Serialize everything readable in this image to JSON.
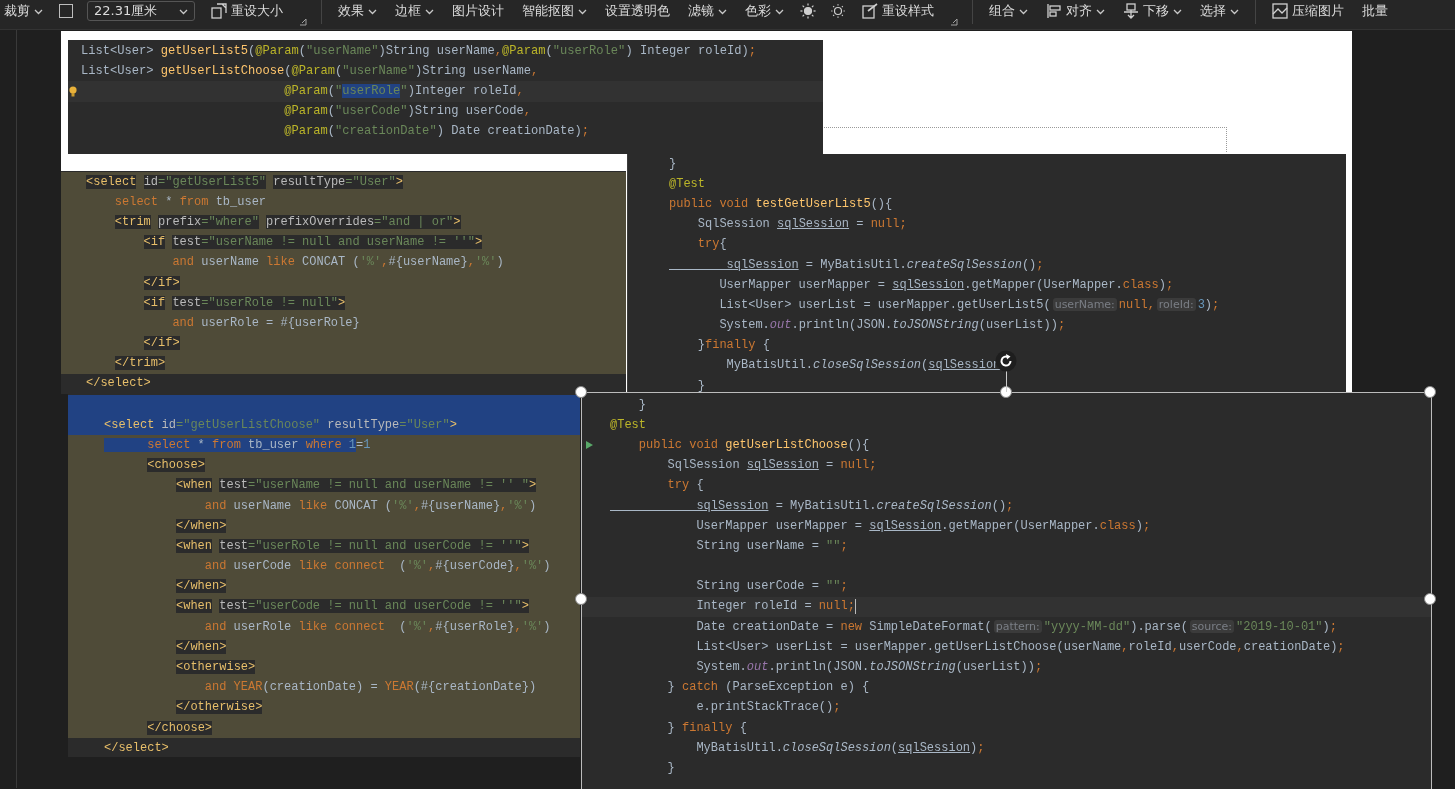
{
  "toolbar": {
    "groups": [
      [
        {
          "kind": "dropdown",
          "label": "裁剪"
        },
        {
          "kind": "checkbox",
          "checked": false
        },
        {
          "kind": "field",
          "value": "22.31厘米"
        },
        {
          "kind": "resize",
          "label": "重设大小"
        },
        {
          "kind": "launcher"
        }
      ],
      [
        {
          "kind": "dropdown",
          "label": "效果"
        },
        {
          "kind": "dropdown",
          "label": "边框"
        },
        {
          "kind": "button",
          "label": "图片设计"
        },
        {
          "kind": "dropdown",
          "label": "智能抠图"
        },
        {
          "kind": "button",
          "label": "设置透明色"
        },
        {
          "kind": "dropdown",
          "label": "滤镜"
        },
        {
          "kind": "dropdown",
          "label": "色彩"
        },
        {
          "kind": "sun"
        },
        {
          "kind": "sun-dim"
        },
        {
          "kind": "reset-style",
          "label": "重设样式"
        },
        {
          "kind": "launcher"
        }
      ],
      [
        {
          "kind": "dropdown",
          "label": "组合"
        },
        {
          "kind": "align",
          "label": "对齐"
        },
        {
          "kind": "send-back",
          "label": "下移"
        },
        {
          "kind": "dropdown",
          "label": "选择"
        }
      ],
      [
        {
          "kind": "compress",
          "label": "压缩图片"
        },
        {
          "kind": "button",
          "label": "批量"
        }
      ]
    ]
  },
  "document": {
    "images": [
      {
        "kind": "code",
        "selected": false,
        "lines": [
          {
            "tokens": [
              {
                "text": "List<User> ",
                "kind": "p"
              },
              {
                "text": "getUserList5",
                "kind": "fn"
              },
              {
                "text": "(",
                "kind": "p"
              },
              {
                "text": "@Param",
                "kind": "ann"
              },
              {
                "text": "(",
                "kind": "p"
              },
              {
                "text": "\"userName\"",
                "kind": "str"
              },
              {
                "text": ")String userName",
                "kind": "p"
              },
              {
                "text": ",",
                "kind": "kw"
              },
              {
                "text": "@Param",
                "kind": "ann"
              },
              {
                "text": "(",
                "kind": "p"
              },
              {
                "text": "\"userRole\"",
                "kind": "str"
              },
              {
                "text": ") Integer roleId)",
                "kind": "p"
              },
              {
                "text": ";",
                "kind": "kw"
              }
            ]
          },
          {
            "tokens": [
              {
                "text": "List<User> ",
                "kind": "p"
              },
              {
                "text": "getUserListChoose",
                "kind": "fn"
              },
              {
                "text": "(",
                "kind": "p"
              },
              {
                "text": "@Param",
                "kind": "ann"
              },
              {
                "text": "(",
                "kind": "p"
              },
              {
                "text": "\"userName\"",
                "kind": "str"
              },
              {
                "text": ")String userName",
                "kind": "p"
              },
              {
                "text": ",",
                "kind": "kw"
              }
            ]
          },
          {
            "current": true,
            "bulb": true,
            "tokens": [
              {
                "text": "                            @Param",
                "kind": "ann"
              },
              {
                "text": "(",
                "kind": "p"
              },
              {
                "text": "\"",
                "kind": "str"
              },
              {
                "text": "userRole",
                "kind": "str",
                "in_selection": true
              },
              {
                "text": "\"",
                "kind": "str"
              },
              {
                "text": ")Integer roleId",
                "kind": "p"
              },
              {
                "text": ",",
                "kind": "kw"
              }
            ]
          },
          {
            "tokens": [
              {
                "text": "                            @Param",
                "kind": "ann"
              },
              {
                "text": "(",
                "kind": "p"
              },
              {
                "text": "\"userCode\"",
                "kind": "str"
              },
              {
                "text": ")String userCode",
                "kind": "p"
              },
              {
                "text": ",",
                "kind": "kw"
              }
            ]
          },
          {
            "tokens": [
              {
                "text": "                            @Param",
                "kind": "ann"
              },
              {
                "text": "(",
                "kind": "p"
              },
              {
                "text": "\"creationDate\"",
                "kind": "str"
              },
              {
                "text": ") Date creationDate)",
                "kind": "p"
              },
              {
                "text": ";",
                "kind": "kw"
              }
            ]
          }
        ]
      },
      {
        "kind": "code",
        "selected": false,
        "lines": [
          {
            "in_scope": true,
            "tokens": [
              {
                "text": "<select",
                "kind": "tag",
                "boxed": true
              },
              {
                "text": " id",
                "kind": "attr",
                "boxed": true
              },
              {
                "text": "=\"getUserList5\"",
                "kind": "str",
                "boxed": true
              },
              {
                "text": " resultType",
                "kind": "attr",
                "boxed": true
              },
              {
                "text": "=\"User\"",
                "kind": "str",
                "boxed": true
              },
              {
                "text": ">",
                "kind": "tag",
                "boxed": true
              }
            ]
          },
          {
            "in_scope": true,
            "tokens": [
              {
                "text": "    select",
                "kind": "kw"
              },
              {
                "text": " * ",
                "kind": "p"
              },
              {
                "text": "from",
                "kind": "kw"
              },
              {
                "text": " tb_user",
                "kind": "p"
              }
            ]
          },
          {
            "in_scope": true,
            "tokens": [
              {
                "text": "    <trim",
                "kind": "tag",
                "boxed": true
              },
              {
                "text": " prefix",
                "kind": "attr",
                "boxed": true
              },
              {
                "text": "=\"where\"",
                "kind": "str",
                "boxed": true
              },
              {
                "text": " prefixOverrides",
                "kind": "attr",
                "boxed": true
              },
              {
                "text": "=\"and | or\"",
                "kind": "str",
                "boxed": true
              },
              {
                "text": ">",
                "kind": "tag",
                "boxed": true
              }
            ]
          },
          {
            "in_scope": true,
            "tokens": [
              {
                "text": "        <if",
                "kind": "tag",
                "boxed": true
              },
              {
                "text": " test",
                "kind": "attr",
                "boxed": true
              },
              {
                "text": "=\"userName != null and userName != ''\"",
                "kind": "str",
                "boxed": true
              },
              {
                "text": ">",
                "kind": "tag",
                "boxed": true
              }
            ]
          },
          {
            "in_scope": true,
            "tokens": [
              {
                "text": "            and",
                "kind": "kw"
              },
              {
                "text": " userName ",
                "kind": "p"
              },
              {
                "text": "like",
                "kind": "kw"
              },
              {
                "text": " CONCAT (",
                "kind": "p"
              },
              {
                "text": "'%'",
                "kind": "str"
              },
              {
                "text": ",",
                "kind": "kw"
              },
              {
                "text": "#{userName}",
                "kind": "p"
              },
              {
                "text": ",",
                "kind": "kw"
              },
              {
                "text": "'%'",
                "kind": "str"
              },
              {
                "text": ")",
                "kind": "p"
              }
            ]
          },
          {
            "in_scope": true,
            "tokens": [
              {
                "text": "        </if>",
                "kind": "tag",
                "boxed": true
              }
            ]
          },
          {
            "in_scope": true,
            "tokens": [
              {
                "text": "        <if",
                "kind": "tag",
                "boxed": true
              },
              {
                "text": " test",
                "kind": "attr",
                "boxed": true
              },
              {
                "text": "=\"userRole != null\"",
                "kind": "str",
                "boxed": true
              },
              {
                "text": ">",
                "kind": "tag",
                "boxed": true
              }
            ]
          },
          {
            "in_scope": true,
            "tokens": [
              {
                "text": "            and",
                "kind": "kw"
              },
              {
                "text": " userRole = #{userRole}",
                "kind": "p"
              }
            ]
          },
          {
            "in_scope": true,
            "tokens": [
              {
                "text": "        </if>",
                "kind": "tag",
                "boxed": true
              }
            ]
          },
          {
            "in_scope": true,
            "tokens": [
              {
                "text": "    </trim>",
                "kind": "tag",
                "boxed": true
              }
            ]
          },
          {
            "tokens": [
              {
                "text": "</select>",
                "kind": "tag"
              }
            ]
          }
        ]
      },
      {
        "kind": "code",
        "selected": false,
        "lines": [
          {
            "tokens": [
              {
                "text": "}",
                "kind": "p"
              }
            ]
          },
          {
            "tokens": [
              {
                "text": "@Test",
                "kind": "ann"
              }
            ]
          },
          {
            "tokens": [
              {
                "text": "public void ",
                "kind": "kw"
              },
              {
                "text": "testGetUserList5",
                "kind": "fn"
              },
              {
                "text": "(){",
                "kind": "p"
              }
            ]
          },
          {
            "tokens": [
              {
                "text": "    SqlSession ",
                "kind": "p"
              },
              {
                "text": "sqlSession",
                "kind": "ul"
              },
              {
                "text": " = ",
                "kind": "p"
              },
              {
                "text": "null;",
                "kind": "kw"
              }
            ]
          },
          {
            "tokens": [
              {
                "text": "    try",
                "kind": "kw"
              },
              {
                "text": "{",
                "kind": "p"
              }
            ]
          },
          {
            "tokens": [
              {
                "text": "        sqlSession",
                "kind": "ul"
              },
              {
                "text": " = MyBatisUtil.",
                "kind": "p"
              },
              {
                "text": "createSqlSession",
                "kind": "it"
              },
              {
                "text": "()",
                "kind": "p"
              },
              {
                "text": ";",
                "kind": "kw"
              }
            ]
          },
          {
            "tokens": [
              {
                "text": "       UserMapper userMapper = ",
                "kind": "p"
              },
              {
                "text": "sqlSession",
                "kind": "ul"
              },
              {
                "text": ".getMapper(UserMapper.",
                "kind": "p"
              },
              {
                "text": "class",
                "kind": "kw"
              },
              {
                "text": ")",
                "kind": "p"
              },
              {
                "text": ";",
                "kind": "kw"
              }
            ]
          },
          {
            "tokens": [
              {
                "text": "       List<User> userList = userMapper.getUserList5(",
                "kind": "p"
              },
              {
                "text": "userName:",
                "kind": "hint"
              },
              {
                "text": "null,",
                "kind": "kw"
              },
              {
                "text": "roleId:",
                "kind": "hint"
              },
              {
                "text": "3",
                "kind": "num"
              },
              {
                "text": ")",
                "kind": "p"
              },
              {
                "text": ";",
                "kind": "kw"
              }
            ]
          },
          {
            "tokens": [
              {
                "text": "       System.",
                "kind": "p"
              },
              {
                "text": "out",
                "kind": "fld"
              },
              {
                "text": ".println(JSON.",
                "kind": "p"
              },
              {
                "text": "toJSONString",
                "kind": "it"
              },
              {
                "text": "(userList))",
                "kind": "p"
              },
              {
                "text": ";",
                "kind": "kw"
              }
            ]
          },
          {
            "tokens": [
              {
                "text": "    }",
                "kind": "p"
              },
              {
                "text": "finally",
                "kind": "kw"
              },
              {
                "text": " {",
                "kind": "p"
              }
            ]
          },
          {
            "tokens": [
              {
                "text": "        MyBatisUtil.",
                "kind": "p"
              },
              {
                "text": "closeSqlSession",
                "kind": "it"
              },
              {
                "text": "(",
                "kind": "p"
              },
              {
                "text": "sqlSession",
                "kind": "ul"
              }
            ]
          },
          {
            "tokens": [
              {
                "text": "    }",
                "kind": "p"
              }
            ]
          }
        ]
      },
      {
        "kind": "code",
        "selected": false,
        "lines": [
          {
            "in_selection": true
          },
          {
            "in_selection": true,
            "tokens": [
              {
                "text": "<select",
                "kind": "tag"
              },
              {
                "text": " id",
                "kind": "attr"
              },
              {
                "text": "=\"getUserListChoose\"",
                "kind": "str"
              },
              {
                "text": " resultType",
                "kind": "attr"
              },
              {
                "text": "=\"User\"",
                "kind": "str"
              },
              {
                "text": ">",
                "kind": "tag"
              }
            ]
          },
          {
            "in_scope": true,
            "tokens": [
              {
                "text": "      select",
                "kind": "kw",
                "in_selection": true
              },
              {
                "text": " * ",
                "kind": "p",
                "in_selection": true
              },
              {
                "text": "from",
                "kind": "kw",
                "in_selection": true
              },
              {
                "text": " tb_user ",
                "kind": "p",
                "in_selection": true
              },
              {
                "text": "where",
                "kind": "kw",
                "in_selection": true
              },
              {
                "text": " 1",
                "kind": "num",
                "in_selection": true
              },
              {
                "text": "=",
                "kind": "p"
              },
              {
                "text": "1",
                "kind": "num"
              }
            ]
          },
          {
            "in_scope": true,
            "tokens": [
              {
                "text": "      <choose>",
                "kind": "tag",
                "boxed": true
              }
            ]
          },
          {
            "in_scope": true,
            "tokens": [
              {
                "text": "          <when",
                "kind": "tag",
                "boxed": true
              },
              {
                "text": " test",
                "kind": "attr",
                "boxed": true
              },
              {
                "text": "=\"userName != null and userName != '' \"",
                "kind": "str",
                "boxed": true
              },
              {
                "text": ">",
                "kind": "tag",
                "boxed": true
              }
            ]
          },
          {
            "in_scope": true,
            "tokens": [
              {
                "text": "              and",
                "kind": "kw"
              },
              {
                "text": " userName ",
                "kind": "p"
              },
              {
                "text": "like",
                "kind": "kw"
              },
              {
                "text": " CONCAT (",
                "kind": "p"
              },
              {
                "text": "'%'",
                "kind": "str"
              },
              {
                "text": ",",
                "kind": "kw"
              },
              {
                "text": "#{userName}",
                "kind": "p"
              },
              {
                "text": ",",
                "kind": "kw"
              },
              {
                "text": "'%'",
                "kind": "str"
              },
              {
                "text": ")",
                "kind": "p"
              }
            ]
          },
          {
            "in_scope": true,
            "tokens": [
              {
                "text": "          </when>",
                "kind": "tag",
                "boxed": true
              }
            ]
          },
          {
            "in_scope": true,
            "tokens": [
              {
                "text": "          <when",
                "kind": "tag",
                "boxed": true
              },
              {
                "text": " test",
                "kind": "attr",
                "boxed": true
              },
              {
                "text": "=\"userRole != null and userCode != ''\"",
                "kind": "str",
                "boxed": true
              },
              {
                "text": ">",
                "kind": "tag",
                "boxed": true
              }
            ]
          },
          {
            "in_scope": true,
            "tokens": [
              {
                "text": "              and",
                "kind": "kw"
              },
              {
                "text": " userCode ",
                "kind": "p"
              },
              {
                "text": "like connect",
                "kind": "kw"
              },
              {
                "text": "  (",
                "kind": "p"
              },
              {
                "text": "'%'",
                "kind": "str"
              },
              {
                "text": ",",
                "kind": "kw"
              },
              {
                "text": "#{userCode}",
                "kind": "p"
              },
              {
                "text": ",",
                "kind": "kw"
              },
              {
                "text": "'%'",
                "kind": "str"
              },
              {
                "text": ")",
                "kind": "p"
              }
            ]
          },
          {
            "in_scope": true,
            "tokens": [
              {
                "text": "          </when>",
                "kind": "tag",
                "boxed": true
              }
            ]
          },
          {
            "in_scope": true,
            "tokens": [
              {
                "text": "          <when",
                "kind": "tag",
                "boxed": true
              },
              {
                "text": " test",
                "kind": "attr",
                "boxed": true
              },
              {
                "text": "=\"userCode != null and userCode != ''\"",
                "kind": "str",
                "boxed": true
              },
              {
                "text": ">",
                "kind": "tag",
                "boxed": true
              }
            ]
          },
          {
            "in_scope": true,
            "tokens": [
              {
                "text": "              and",
                "kind": "kw"
              },
              {
                "text": " userRole ",
                "kind": "p"
              },
              {
                "text": "like connect",
                "kind": "kw"
              },
              {
                "text": "  (",
                "kind": "p"
              },
              {
                "text": "'%'",
                "kind": "str"
              },
              {
                "text": ",",
                "kind": "kw"
              },
              {
                "text": "#{userRole}",
                "kind": "p"
              },
              {
                "text": ",",
                "kind": "kw"
              },
              {
                "text": "'%'",
                "kind": "str"
              },
              {
                "text": ")",
                "kind": "p"
              }
            ]
          },
          {
            "in_scope": true,
            "tokens": [
              {
                "text": "          </when>",
                "kind": "tag",
                "boxed": true
              }
            ]
          },
          {
            "in_scope": true,
            "tokens": [
              {
                "text": "          <otherwise>",
                "kind": "tag",
                "boxed": true
              }
            ]
          },
          {
            "in_scope": true,
            "tokens": [
              {
                "text": "              and",
                "kind": "kw"
              },
              {
                "text": " YEAR",
                "kind": "kw"
              },
              {
                "text": "(creationDate) = ",
                "kind": "p"
              },
              {
                "text": "YEAR",
                "kind": "kw"
              },
              {
                "text": "(#{creationDate})",
                "kind": "p"
              }
            ]
          },
          {
            "in_scope": true,
            "tokens": [
              {
                "text": "          </otherwise>",
                "kind": "tag",
                "boxed": true
              }
            ]
          },
          {
            "in_scope": true,
            "tokens": [
              {
                "text": "      </choose>",
                "kind": "tag",
                "boxed": true
              }
            ]
          },
          {
            "tokens": [
              {
                "text": "</select>",
                "kind": "tag",
                "boxed": true
              }
            ]
          }
        ]
      },
      {
        "kind": "code",
        "selected": true,
        "lines": [
          {
            "tokens": [
              {
                "text": "    }",
                "kind": "p"
              }
            ]
          },
          {
            "tokens": [
              {
                "text": "@Test",
                "kind": "ann"
              }
            ]
          },
          {
            "run": true,
            "tokens": [
              {
                "text": "    public void ",
                "kind": "kw"
              },
              {
                "text": "getUserListChoose",
                "kind": "fn"
              },
              {
                "text": "(){",
                "kind": "p"
              }
            ]
          },
          {
            "tokens": [
              {
                "text": "        SqlSession ",
                "kind": "p"
              },
              {
                "text": "sqlSession",
                "kind": "ul"
              },
              {
                "text": " = ",
                "kind": "p"
              },
              {
                "text": "null;",
                "kind": "kw"
              }
            ]
          },
          {
            "tokens": [
              {
                "text": "        try",
                "kind": "kw"
              },
              {
                "text": " {",
                "kind": "p"
              }
            ]
          },
          {
            "tokens": [
              {
                "text": "            sqlSession",
                "kind": "ul"
              },
              {
                "text": " = MyBatisUtil.",
                "kind": "p"
              },
              {
                "text": "createSqlSession",
                "kind": "it"
              },
              {
                "text": "()",
                "kind": "p"
              },
              {
                "text": ";",
                "kind": "kw"
              }
            ]
          },
          {
            "tokens": [
              {
                "text": "            UserMapper userMapper = ",
                "kind": "p"
              },
              {
                "text": "sqlSession",
                "kind": "ul"
              },
              {
                "text": ".getMapper(UserMapper.",
                "kind": "p"
              },
              {
                "text": "class",
                "kind": "kw"
              },
              {
                "text": ")",
                "kind": "p"
              },
              {
                "text": ";",
                "kind": "kw"
              }
            ]
          },
          {
            "tokens": [
              {
                "text": "            String userName = ",
                "kind": "p"
              },
              {
                "text": "\"\"",
                "kind": "str"
              },
              {
                "text": ";",
                "kind": "kw"
              }
            ]
          },
          {
            "gap_above": true,
            "tokens": [
              {
                "text": "            String userCode = ",
                "kind": "p"
              },
              {
                "text": "\"\"",
                "kind": "str"
              },
              {
                "text": ";",
                "kind": "kw"
              }
            ]
          },
          {
            "current": true,
            "caret": true,
            "tokens": [
              {
                "text": "            Integer roleId = ",
                "kind": "p"
              },
              {
                "text": "null;",
                "kind": "kw"
              }
            ]
          },
          {
            "tokens": [
              {
                "text": "            Date creationDate = ",
                "kind": "p"
              },
              {
                "text": "new",
                "kind": "kw"
              },
              {
                "text": " SimpleDateFormat(",
                "kind": "p"
              },
              {
                "text": "pattern:",
                "kind": "hint"
              },
              {
                "text": "\"yyyy-MM-dd\"",
                "kind": "str"
              },
              {
                "text": ").parse(",
                "kind": "p"
              },
              {
                "text": "source:",
                "kind": "hint"
              },
              {
                "text": "\"2019-10-01\"",
                "kind": "str"
              },
              {
                "text": ")",
                "kind": "p"
              },
              {
                "text": ";",
                "kind": "kw"
              }
            ]
          },
          {
            "tokens": [
              {
                "text": "            List<User> userList = userMapper.getUserListChoose(userName",
                "kind": "p"
              },
              {
                "text": ",",
                "kind": "kw"
              },
              {
                "text": "roleId",
                "kind": "p"
              },
              {
                "text": ",",
                "kind": "kw"
              },
              {
                "text": "userCode",
                "kind": "p"
              },
              {
                "text": ",",
                "kind": "kw"
              },
              {
                "text": "creationDate)",
                "kind": "p"
              },
              {
                "text": ";",
                "kind": "kw"
              }
            ]
          },
          {
            "tokens": [
              {
                "text": "            System.",
                "kind": "p"
              },
              {
                "text": "out",
                "kind": "fld"
              },
              {
                "text": ".println(JSON.",
                "kind": "p"
              },
              {
                "text": "toJSONString",
                "kind": "it"
              },
              {
                "text": "(userList))",
                "kind": "p"
              },
              {
                "text": ";",
                "kind": "kw"
              }
            ]
          },
          {
            "tokens": [
              {
                "text": "        } ",
                "kind": "p"
              },
              {
                "text": "catch",
                "kind": "kw"
              },
              {
                "text": " (ParseException e) {",
                "kind": "p"
              }
            ]
          },
          {
            "tokens": [
              {
                "text": "            e.printStackTrace()",
                "kind": "p"
              },
              {
                "text": ";",
                "kind": "kw"
              }
            ]
          },
          {
            "tokens": [
              {
                "text": "        } ",
                "kind": "p"
              },
              {
                "text": "finally",
                "kind": "kw"
              },
              {
                "text": " {",
                "kind": "p"
              }
            ]
          },
          {
            "tokens": [
              {
                "text": "            MyBatisUtil.",
                "kind": "p"
              },
              {
                "text": "closeSqlSession",
                "kind": "it"
              },
              {
                "text": "(",
                "kind": "p"
              },
              {
                "text": "sqlSession",
                "kind": "ul"
              },
              {
                "text": ")",
                "kind": "p"
              },
              {
                "text": ";",
                "kind": "kw"
              }
            ]
          },
          {
            "tokens": [
              {
                "text": "        }",
                "kind": "p"
              }
            ]
          }
        ]
      }
    ]
  }
}
